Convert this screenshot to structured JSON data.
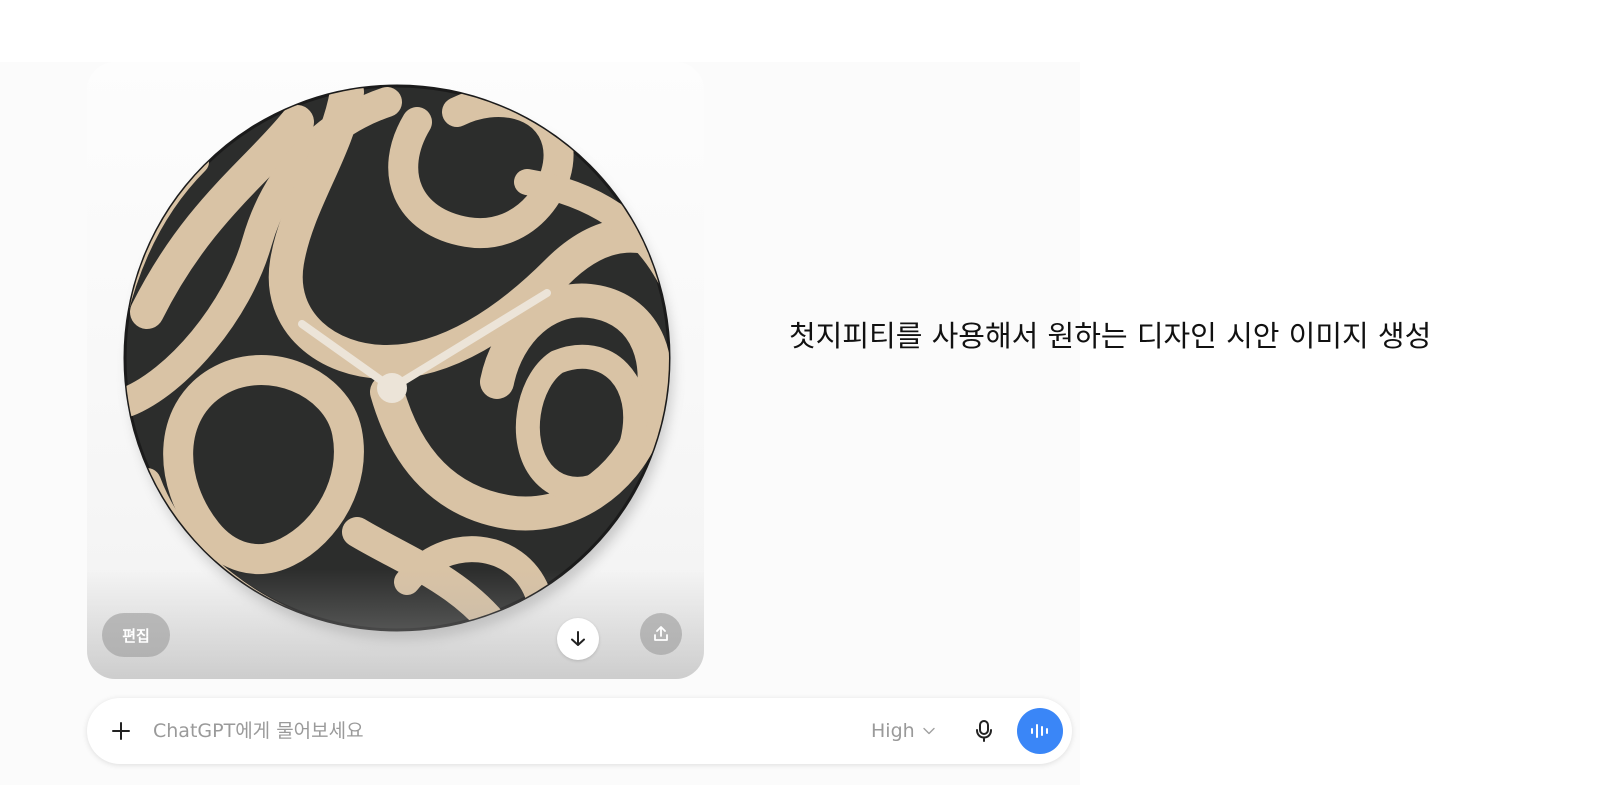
{
  "image": {
    "alt": "생성된 벽시계 디자인 시안 이미지",
    "edit_label": "편집",
    "download_icon": "download-icon",
    "share_icon": "share-icon"
  },
  "caption": "첫지피티를 사용해서 원하는 디자인 시안 이미지 생성",
  "composer": {
    "placeholder": "ChatGPT에게 물어보세요",
    "value": "",
    "model_label": "High",
    "add_icon": "plus-icon",
    "mic_icon": "mic-icon",
    "voice_icon": "voice-mode-icon"
  },
  "colors": {
    "accent": "#3a86f7",
    "clock_face": "#2c2d2c",
    "clock_relief": "#d9c3a5"
  }
}
